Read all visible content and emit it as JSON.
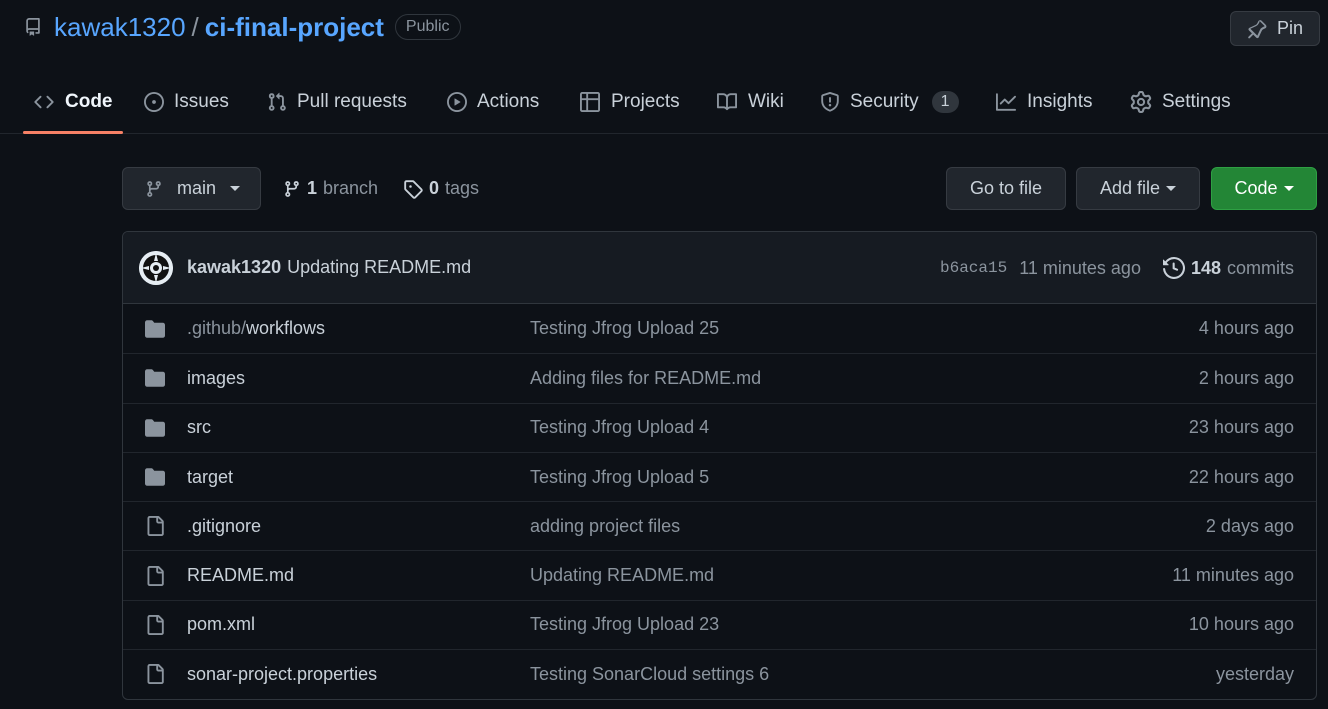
{
  "repo": {
    "owner": "kawak1320",
    "separator": "/",
    "name": "ci-final-project",
    "visibility": "Public"
  },
  "pin": {
    "label": "Pin"
  },
  "tabs": [
    {
      "label": "Code",
      "icon": "code-icon",
      "active": true
    },
    {
      "label": "Issues",
      "icon": "issue-opened-icon"
    },
    {
      "label": "Pull requests",
      "icon": "git-pull-request-icon"
    },
    {
      "label": "Actions",
      "icon": "play-icon"
    },
    {
      "label": "Projects",
      "icon": "table-icon"
    },
    {
      "label": "Wiki",
      "icon": "book-icon"
    },
    {
      "label": "Security",
      "icon": "shield-icon",
      "count": "1"
    },
    {
      "label": "Insights",
      "icon": "graph-icon"
    },
    {
      "label": "Settings",
      "icon": "gear-icon"
    }
  ],
  "branch_bar": {
    "branch": "main",
    "branch_count": "1",
    "branch_label": "branch",
    "tag_count": "0",
    "tag_label": "tags",
    "go_to_file": "Go to file",
    "add_file": "Add file",
    "code": "Code"
  },
  "latest_commit": {
    "author": "kawak1320",
    "message": "Updating README.md",
    "sha": "b6aca15",
    "time": "11 minutes ago",
    "commit_count": "148",
    "commit_label": "commits"
  },
  "files": [
    {
      "type": "folder",
      "name_prefix": ".github/",
      "name": "workflows",
      "message": "Testing Jfrog Upload 25",
      "age": "4 hours ago"
    },
    {
      "type": "folder",
      "name_prefix": "",
      "name": "images",
      "message": "Adding files for README.md",
      "age": "2 hours ago"
    },
    {
      "type": "folder",
      "name_prefix": "",
      "name": "src",
      "message": "Testing Jfrog Upload 4",
      "age": "23 hours ago"
    },
    {
      "type": "folder",
      "name_prefix": "",
      "name": "target",
      "message": "Testing Jfrog Upload 5",
      "age": "22 hours ago"
    },
    {
      "type": "file",
      "name_prefix": "",
      "name": ".gitignore",
      "message": "adding project files",
      "age": "2 days ago"
    },
    {
      "type": "file",
      "name_prefix": "",
      "name": "README.md",
      "message": "Updating README.md",
      "age": "11 minutes ago"
    },
    {
      "type": "file",
      "name_prefix": "",
      "name": "pom.xml",
      "message": "Testing Jfrog Upload 23",
      "age": "10 hours ago"
    },
    {
      "type": "file",
      "name_prefix": "",
      "name": "sonar-project.properties",
      "message": "Testing SonarCloud settings 6",
      "age": "yesterday"
    }
  ],
  "colors": {
    "background": "#0d1117",
    "link": "#58a6ff",
    "active_tab_underline": "#f78166",
    "primary_button": "#238636"
  }
}
